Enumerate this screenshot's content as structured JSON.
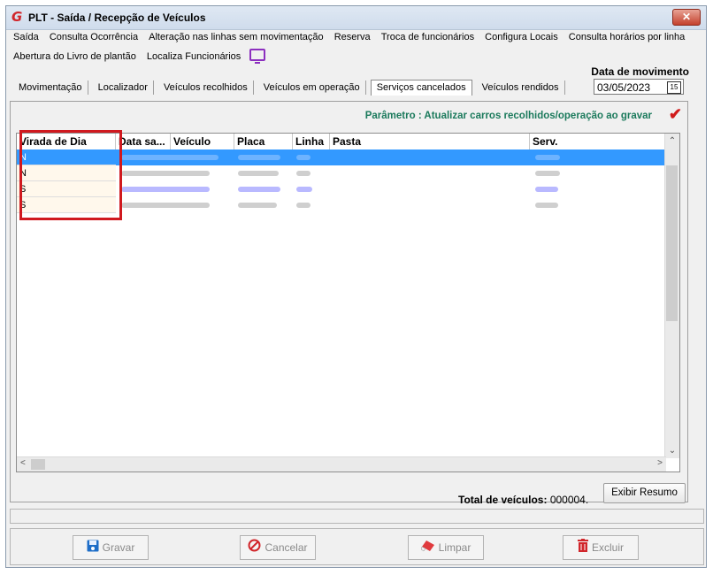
{
  "window": {
    "title": "PLT - Saída / Recepção de Veículos",
    "close_label": "✕"
  },
  "menu": {
    "row1": [
      "Saída",
      "Consulta Ocorrência",
      "Alteração nas linhas sem movimentação",
      "Reserva",
      "Troca de funcionários",
      "Configura Locais",
      "Consulta horários por linha"
    ],
    "row2": [
      "Abertura do Livro de plantão",
      "Localiza Funcionários"
    ]
  },
  "date": {
    "label": "Data de movimento",
    "value": "03/05/2023",
    "calendar_icon": "15"
  },
  "tabs": [
    "Movimentação",
    "Localizador",
    "Veículos recolhidos",
    "Veículos em operação",
    "Serviços cancelados",
    "Veículos rendidos"
  ],
  "active_tab": "Serviços cancelados",
  "parametro": "Parâmetro : Atualizar carros recolhidos/operação ao gravar",
  "grid": {
    "columns": [
      "Virada de Dia",
      "Data sa...",
      "Veículo",
      "Placa",
      "Linha",
      "Pasta",
      "Serv."
    ],
    "rows": [
      {
        "virada": "N",
        "selected": true
      },
      {
        "virada": "N",
        "selected": false
      },
      {
        "virada": "S",
        "selected": false
      },
      {
        "virada": "S",
        "selected": false
      }
    ]
  },
  "total": {
    "label": "Total de veículos:",
    "value": "000004."
  },
  "exibir_resumo": "Exibir Resumo",
  "actions": {
    "gravar": "Gravar",
    "cancelar": "Cancelar",
    "limpar": "Limpar",
    "excluir": "Excluir"
  },
  "colors": {
    "selection": "#3399ff",
    "parameter_text": "#1b7a5c",
    "highlight_box": "#d0191f",
    "check": "#d11b1b"
  }
}
